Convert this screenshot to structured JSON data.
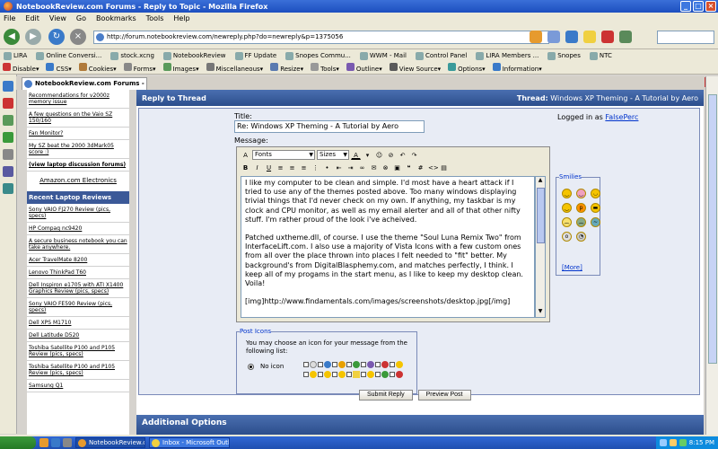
{
  "window": {
    "title": "NotebookReview.com Forums - Reply to Topic - Mozilla Firefox"
  },
  "menu": [
    "File",
    "Edit",
    "View",
    "Go",
    "Bookmarks",
    "Tools",
    "Help"
  ],
  "nav": {
    "url": "http://forum.notebookreview.com/newreply.php?do=newreply&p=1375056"
  },
  "bookmarks": [
    "LIRA",
    "Online Conversi...",
    "stock.xcng",
    "NotebookReview",
    "FF Update",
    "Snopes Commu...",
    "WWM - Mail",
    "Control Panel",
    "LIRA Members ...",
    "Snopes",
    "NTC"
  ],
  "devtoolbar": [
    "Disable▾",
    "CSS▾",
    "Cookies▾",
    "Forms▾",
    "Images▾",
    "Miscellaneous▾",
    "Resize▾",
    "Tools▾",
    "Outline▾",
    "View Source▾",
    "Options▾",
    "Information▾"
  ],
  "tab": {
    "label": "NotebookReview.com Forums - Repl..."
  },
  "sidebar": {
    "items_top": [
      "Recommendations for v2000z memory issue",
      "A few questions on the Vaio SZ 150/160",
      "Fan Monitor?",
      "My SZ beat the 2000 3dMark05 score :)"
    ],
    "view_link": "(view laptop discussion forums)",
    "sponsor": "Amazon.com Electronics",
    "reviews_header": "Recent Laptop Reviews",
    "reviews": [
      "Sony VAIO FJ270 Review (pics, specs)",
      "HP Compaq nc9420",
      "A secure business notebook you can take anywhere.",
      "Acer TravelMate 8200",
      "Lenovo ThinkPad T60",
      "Dell Inspiron e1705 with ATI X1400 Graphics Review (pics, specs)",
      "Sony VAIO FE590 Review (pics, specs)",
      "Dell XPS M1710",
      "Dell Latitude D520",
      "Toshiba Satellite P100 and P105 Review (pics, specs)",
      "Toshiba Satellite P100 and P105 Review (pics, specs)",
      "Samsung Q1"
    ]
  },
  "thread": {
    "reply_label": "Reply to Thread",
    "thread_label": "Thread:",
    "thread_title": "Windows XP Theming - A Tutorial by Aero"
  },
  "form": {
    "title_label": "Title:",
    "title_value": "Re: Windows XP Theming - A Tutorial by Aero",
    "logged_in_label": "Logged in as",
    "username": "FalsePerc",
    "message_label": "Message:",
    "font_select": "Fonts",
    "size_select": "Sizes",
    "message_p1": "I like my computer to be clean and simple. I'd most have a heart attack if I tried to use any of the themes posted above. Too many windows displaying trivial things that I'd never check on my own. If anything, my taskbar is my clock and CPU monitor, as well as my email alerter and all of that other nifty stuff. I'm rather proud of the look i've acheived.",
    "message_p2": "Patched uxtheme.dll, of course. I use the theme \"Soul Luna Remix Two\" from InterfaceLift.com. I also use a majority of Vista Icons with a few custom ones from all over the place thrown into places I felt needed to \"fit\" better. My background's from DigitalBlasphemy.com, and matches perfectly, I think. I keep all of my progams in the start menu, as I like to keep my desktop clean. Voila!",
    "message_p3": "[img]http://www.findamentals.com/images/screenshots/desktop.jpg[/img]",
    "smilies_label": "Smilies",
    "more_label": "[More]",
    "post_icons_label": "Post Icons",
    "post_icons_desc": "You may choose an icon for your message from the following list:",
    "no_icon_label": "No icon",
    "submit_label": "Submit Reply",
    "preview_label": "Preview Post"
  },
  "additional_options": "Additional Options",
  "taskbar": {
    "task1": "NotebookReview.com...",
    "task2": "Inbox - Microsoft Outl...",
    "clock": "8:15 PM"
  }
}
